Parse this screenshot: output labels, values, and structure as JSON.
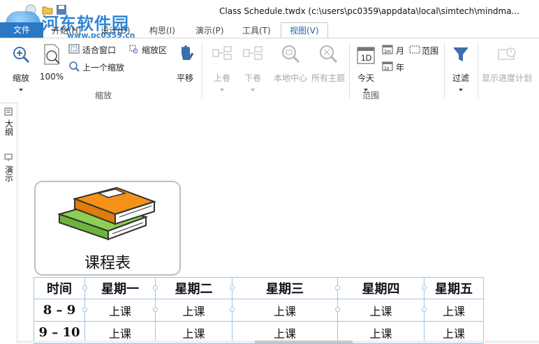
{
  "window": {
    "title": "Class Schedule.twdx (c:\\users\\pc0359\\appdata\\local\\simtech\\mindma..."
  },
  "watermark": {
    "name": "河东软件园",
    "url": "www.pc0359.cn"
  },
  "tabs": {
    "file": "文件",
    "items": [
      "开始(H)",
      "设计(D)",
      "构思(I)",
      "演示(P)",
      "工具(T)",
      "视图(V)"
    ],
    "active": "视图(V)"
  },
  "ribbon": {
    "zoom": {
      "zoom_label": "缩放",
      "percent_label": "100%",
      "fit_window": "适合窗口",
      "zoom_area": "缩放区",
      "prev_zoom": "上一个缩放",
      "pan": "平移",
      "group_label": "缩放"
    },
    "nav": {
      "prev_scroll": "上卷",
      "next_scroll": "下卷",
      "local_center": "本地中心",
      "all_topics": "所有主题"
    },
    "range": {
      "today": "今天",
      "today_icon": "1D",
      "month": "月",
      "month_icon": "1m",
      "year": "年",
      "year_icon": "1y",
      "range": "范围",
      "group_label": "范围"
    },
    "filter": {
      "label": "过滤"
    },
    "progress": {
      "label": "显示进度计划"
    }
  },
  "sidebar": {
    "outline": "大纲",
    "present": "演示"
  },
  "canvas": {
    "topic_title": "课程表",
    "schedule": {
      "headers": [
        "时间",
        "星期一",
        "星期二",
        "星期三",
        "星期四",
        "星期五"
      ],
      "rows": [
        [
          "8 – 9",
          "上课",
          "上课",
          "上课",
          "上课",
          "上课"
        ],
        [
          "9 – 10",
          "上课",
          "上课",
          "上课",
          "上课",
          "上课"
        ]
      ]
    }
  },
  "colors": {
    "accent": "#2b78c5",
    "table_border": "#9fc3e4",
    "book_orange": "#f39217",
    "book_green": "#7cc242"
  }
}
